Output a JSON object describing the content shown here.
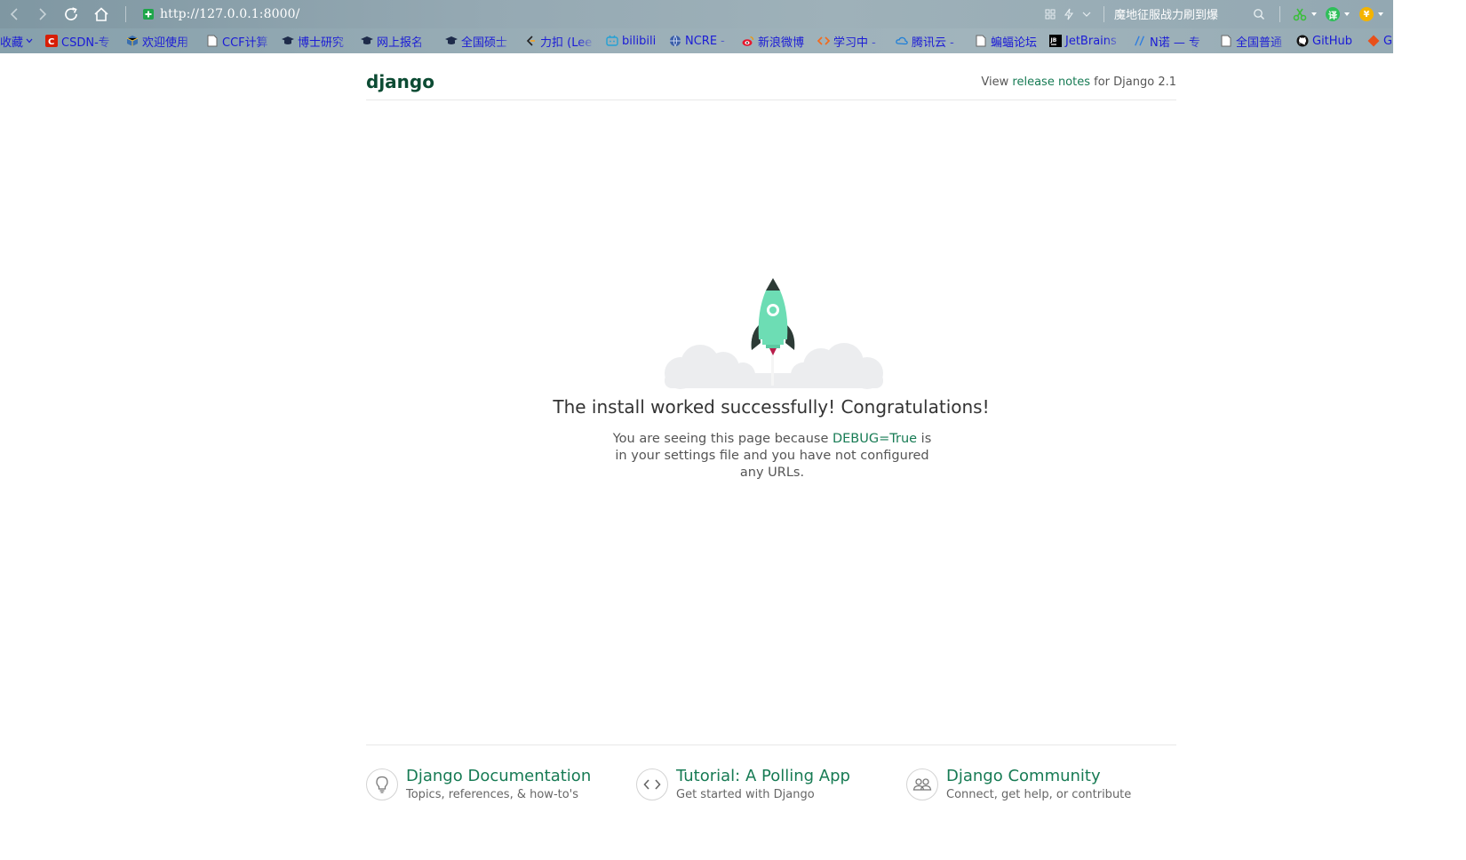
{
  "browser": {
    "url": "http://127.0.0.1:8000/",
    "search_suggestion": "魔地征服战力刷到爆",
    "bookmarks": [
      {
        "label": "收藏",
        "icon": "caret-down-icon"
      },
      {
        "label": "CSDN-专",
        "icon": "csdn-icon"
      },
      {
        "label": "欢迎使用",
        "icon": "cube-icon"
      },
      {
        "label": "CCF计算",
        "icon": "page-icon"
      },
      {
        "label": "博士研究",
        "icon": "graduation-cap-icon"
      },
      {
        "label": "网上报名",
        "icon": "graduation-cap-icon"
      },
      {
        "label": "全国硕士",
        "icon": "graduation-cap-icon"
      },
      {
        "label": "力扣 (Lee",
        "icon": "leetcode-icon"
      },
      {
        "label": "bilibili",
        "icon": "bilibili-icon"
      },
      {
        "label": "NCRE -",
        "icon": "globe-icon"
      },
      {
        "label": "新浪微博",
        "icon": "weibo-icon"
      },
      {
        "label": "学习中 -",
        "icon": "code-bracket-icon"
      },
      {
        "label": "腾讯云 -",
        "icon": "cloud-icon"
      },
      {
        "label": "蝙蝠论坛",
        "icon": "page-icon"
      },
      {
        "label": "JetBrains",
        "icon": "jetbrains-icon"
      },
      {
        "label": "N诺 — 专",
        "icon": "slash-icon"
      },
      {
        "label": "全国普通",
        "icon": "page-icon"
      },
      {
        "label": "GitHub",
        "icon": "github-icon"
      },
      {
        "label": "G",
        "icon": "diamond-icon"
      }
    ],
    "colors": {
      "chrome": "#93a8b2",
      "bookmark_text": "#1b1bd6"
    }
  },
  "page": {
    "logo": "django",
    "release_prefix": "View ",
    "release_link": "release notes",
    "release_suffix": " for Django 2.1",
    "title": "The install worked successfully! Congratulations!",
    "desc_prefix": "You are seeing this page because ",
    "desc_code": "DEBUG=True",
    "desc_suffix": " is in your settings file and you have not configured any URLs.",
    "colors": {
      "brand": "#0c4b33",
      "link": "#177b54",
      "rocket": "#6dddb4"
    }
  },
  "footer": {
    "cards": [
      {
        "title": "Django Documentation",
        "subtitle": "Topics, references, & how-to's",
        "icon": "lightbulb-icon"
      },
      {
        "title": "Tutorial: A Polling App",
        "subtitle": "Get started with Django",
        "icon": "code-icon"
      },
      {
        "title": "Django Community",
        "subtitle": "Connect, get help, or contribute",
        "icon": "people-icon"
      }
    ]
  }
}
